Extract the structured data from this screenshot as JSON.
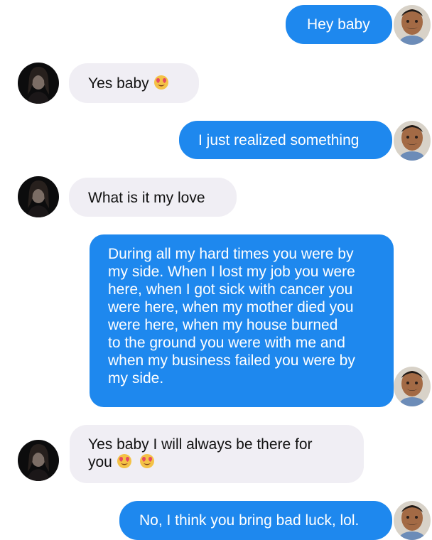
{
  "conversation": {
    "messages": [
      {
        "direction": "sent",
        "text": "Hey baby"
      },
      {
        "direction": "received",
        "text": "Yes baby",
        "emoji": "smiling-face-heart-eyes"
      },
      {
        "direction": "sent",
        "text": "I just realized something"
      },
      {
        "direction": "received",
        "text": "What is it my love"
      },
      {
        "direction": "sent",
        "lines": [
          "During all my hard times you were by",
          "my side. When I lost my job you were",
          "here, when I got sick with cancer you",
          "were here, when my mother died you",
          "were here, when my house burned",
          "to the ground you were with me and",
          "when my business failed you were by",
          "my side."
        ]
      },
      {
        "direction": "received",
        "lines": [
          "Yes baby I will always be there for",
          "you"
        ],
        "emoji": "smiling-face-heart-eyes"
      },
      {
        "direction": "sent",
        "text": "No, I think you bring bad luck, lol."
      }
    ]
  },
  "colors": {
    "sent_bubble": "#1e88ee",
    "received_bubble": "#f0eef4",
    "page_background": "#ffffff"
  },
  "icons": {
    "sender_avatar": "man-with-mustache-avatar",
    "receiver_avatar": "dark-haired-woman-avatar",
    "emoji": "smiling-face-with-heart-eyes-emoji"
  }
}
